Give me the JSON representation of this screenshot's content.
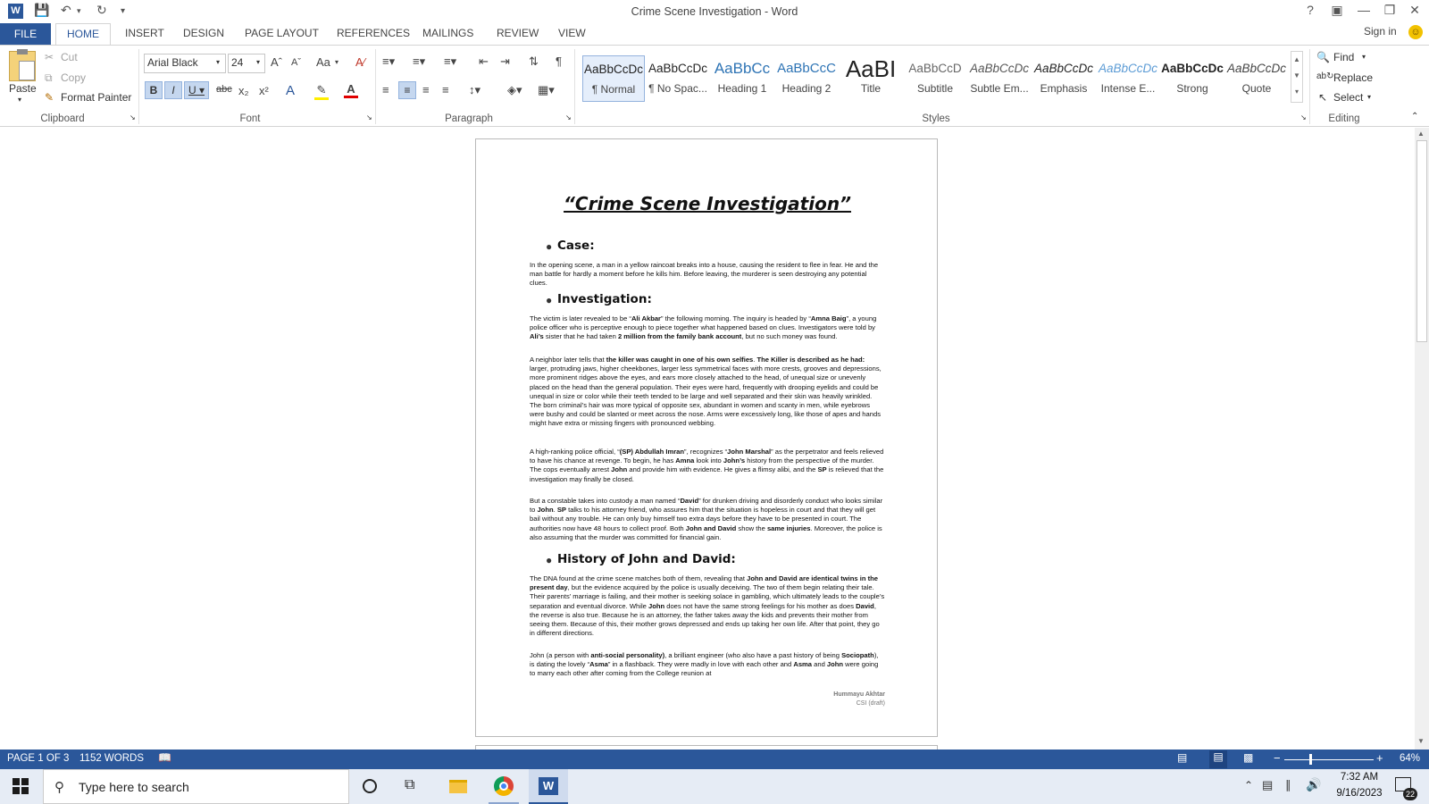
{
  "window": {
    "title": "Crime Scene Investigation - Word"
  },
  "tabs": [
    "FILE",
    "HOME",
    "INSERT",
    "DESIGN",
    "PAGE LAYOUT",
    "REFERENCES",
    "MAILINGS",
    "REVIEW",
    "VIEW"
  ],
  "account": {
    "sign_in": "Sign in"
  },
  "clipboard": {
    "paste": "Paste",
    "cut": "Cut",
    "copy": "Copy",
    "format_painter": "Format Painter",
    "label": "Clipboard"
  },
  "font": {
    "family": "Arial Black",
    "size": "24",
    "label": "Font",
    "case_btn": "Aa"
  },
  "paragraph": {
    "label": "Paragraph"
  },
  "styles": {
    "label": "Styles",
    "items": [
      {
        "preview": "AaBbCcDc",
        "name": "¶ Normal"
      },
      {
        "preview": "AaBbCcDc",
        "name": "¶ No Spac..."
      },
      {
        "preview": "AaBbCc",
        "name": "Heading 1"
      },
      {
        "preview": "AaBbCcC",
        "name": "Heading 2"
      },
      {
        "preview": "AaBI",
        "name": "Title"
      },
      {
        "preview": "AaBbCcD",
        "name": "Subtitle"
      },
      {
        "preview": "AaBbCcDc",
        "name": "Subtle Em..."
      },
      {
        "preview": "AaBbCcDc",
        "name": "Emphasis"
      },
      {
        "preview": "AaBbCcDc",
        "name": "Intense E..."
      },
      {
        "preview": "AaBbCcDc",
        "name": "Strong"
      },
      {
        "preview": "AaBbCcDc",
        "name": "Quote"
      }
    ]
  },
  "editing": {
    "find": "Find",
    "replace": "Replace",
    "select": "Select",
    "label": "Editing"
  },
  "document": {
    "title": "“Crime Scene Investigation”",
    "h_case": "Case:",
    "p_case": "In the opening scene, a man in a yellow raincoat breaks into a house, causing the resident to flee in fear. He and the man battle for hardly a moment before he kills him. Before leaving, the murderer is seen destroying any potential clues.",
    "h_investigation": "Investigation:",
    "footer_name": "Hummayu Akhtar",
    "footer_sub": "CSI (draft)",
    "h_history": "History of John and David:"
  },
  "status": {
    "page": "PAGE 1 OF 3",
    "words": "1152 WORDS",
    "zoom": "64%"
  },
  "taskbar": {
    "search_placeholder": "Type here to search",
    "time": "7:32 AM",
    "date": "9/16/2023",
    "notifications": "22"
  }
}
